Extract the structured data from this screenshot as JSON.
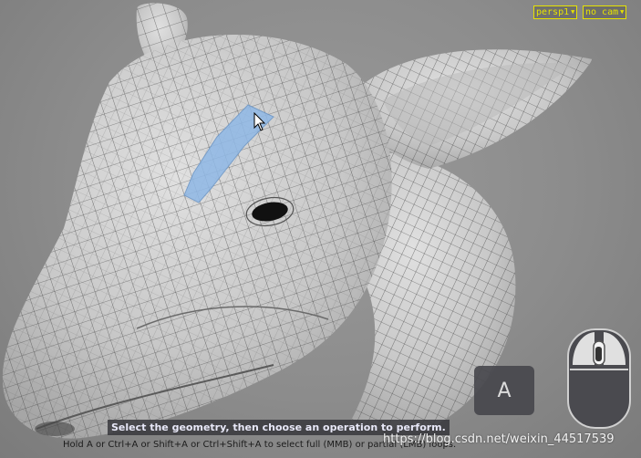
{
  "camera_menus": {
    "camera": "persp1",
    "view": "no cam"
  },
  "viewport": {
    "model": "horse-head-mesh",
    "selection_color": "#8fb8e6",
    "mesh_color": "#d4d4d4"
  },
  "hints": {
    "title": "Select the geometry, then choose an operation to perform.",
    "detail": "Hold A or Ctrl+A or Shift+A or Ctrl+Shift+A to select full (MMB) or partial (LMB) loops."
  },
  "key_indicator": {
    "key": "A"
  },
  "mouse_indicator": {
    "icon": "mouse-icon",
    "highlighted_button": "middle"
  },
  "watermark": "https://blog.csdn.net/weixin_44517539"
}
